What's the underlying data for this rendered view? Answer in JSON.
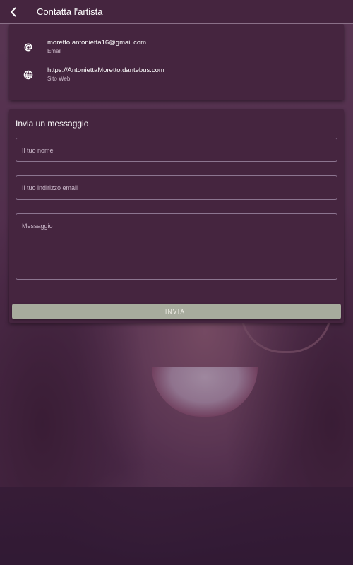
{
  "header": {
    "title": "Contatta l'artista",
    "back_icon": "chevron-left-icon"
  },
  "contacts": [
    {
      "icon": "at-icon",
      "value": "moretto.antonietta16@gmail.com",
      "label": "Email"
    },
    {
      "icon": "globe-icon",
      "value": "https://AntoniettaMoretto.dantebus.com",
      "label": "Sito Web"
    }
  ],
  "form": {
    "title": "Invia un messaggio",
    "name_placeholder": "Il tuo nome",
    "email_placeholder": "Il tuo indirizzo email",
    "message_placeholder": "Messaggio",
    "send_label": "INVIA!"
  },
  "colors": {
    "panel": "#45253f",
    "field_border": "#8c7590",
    "button": "#a7ab9d"
  }
}
